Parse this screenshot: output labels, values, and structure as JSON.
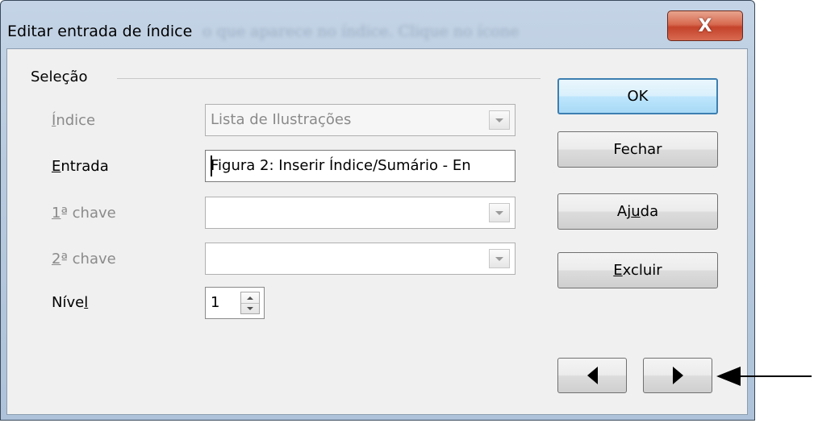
{
  "window": {
    "title": "Editar entrada de índice",
    "background_ghost_text": "o que aparece no índice. Clique no ícone"
  },
  "close_button": {
    "symbol": "X"
  },
  "group": {
    "label": "Seleção"
  },
  "fields": {
    "indice": {
      "label": "Índice",
      "mnemonic": "Í",
      "label_rest": "ndice",
      "value": "Lista de Ilustrações",
      "enabled": false
    },
    "entrada": {
      "label": "Entrada",
      "mnemonic": "E",
      "label_rest": "ntrada",
      "value": "Figura 2: Inserir Índice/Sumário - En",
      "enabled": true
    },
    "chave1": {
      "label": "1ª chave",
      "mnemonic": "1",
      "label_rest": "ª chave",
      "value": "",
      "enabled": false
    },
    "chave2": {
      "label": "2ª chave",
      "mnemonic": "2",
      "label_rest": "ª chave",
      "value": "",
      "enabled": false
    },
    "nivel": {
      "label": "Nível",
      "label_pre": "Níve",
      "mnemonic": "l",
      "value": "1",
      "enabled": true
    }
  },
  "buttons": {
    "ok": "OK",
    "fechar": "Fechar",
    "ajuda_pre": "Aj",
    "ajuda_mnemonic": "u",
    "ajuda_post": "da",
    "excluir_mnemonic": "E",
    "excluir_rest": "xcluir",
    "prev": "◀",
    "next": "▶"
  },
  "colors": {
    "titlebar": "#b8cade",
    "close_button": "#c4422a",
    "default_button_border": "#3c7fb1",
    "disabled_text": "#8a8a8a"
  }
}
